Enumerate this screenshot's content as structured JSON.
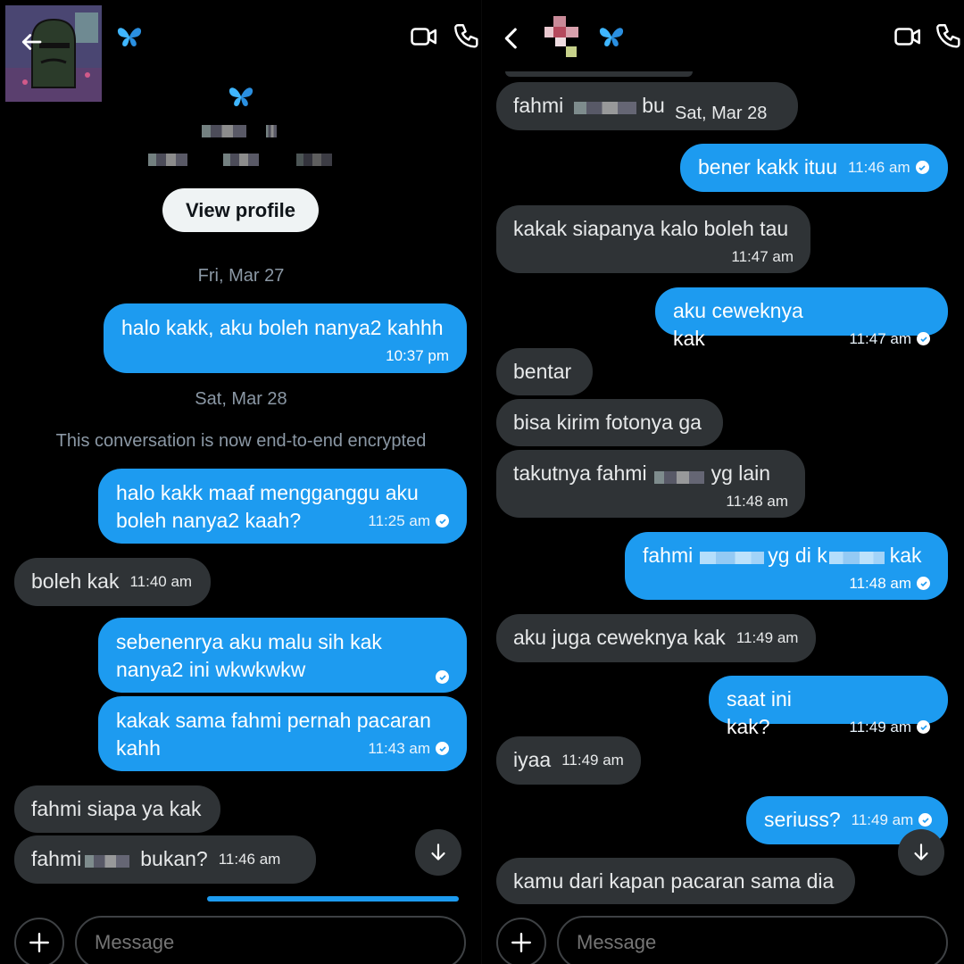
{
  "left": {
    "profile": {
      "view_profile_label": "View profile"
    },
    "dates": {
      "fri": "Fri, Mar 27",
      "sat": "Sat, Mar 28"
    },
    "system_notice": "This conversation is now end-to-end encrypted",
    "messages": [
      {
        "dir": "out",
        "line1": "halo kakk, aku boleh nanya2 kahhh",
        "line2": "",
        "time": "10:37 pm"
      },
      {
        "dir": "out",
        "line1": "halo kakk maaf mengganggu aku",
        "line2": "boleh nanya2 kaah?",
        "time": "11:25 am"
      },
      {
        "dir": "in",
        "line1": "boleh kak",
        "line2": "",
        "time": "11:40 am"
      },
      {
        "dir": "out",
        "line1": "sebenenrya aku malu sih kak",
        "line2": "nanya2 ini wkwkwkw",
        "time": ""
      },
      {
        "dir": "out",
        "line1": "kakak sama fahmi pernah pacaran",
        "line2": "kahh",
        "time": "11:43 am"
      },
      {
        "dir": "in",
        "line1": "fahmi siapa ya kak",
        "line2": "",
        "time": ""
      },
      {
        "dir": "in",
        "line1": "fahmi",
        "line2": "bukan?",
        "time": "11:46 am"
      }
    ],
    "composer": {
      "placeholder": "Message"
    }
  },
  "right": {
    "date_overlay": "Sat, Mar 28",
    "messages": [
      {
        "dir": "in",
        "line1": "fahmi",
        "line2": "bu",
        "time": ""
      },
      {
        "dir": "out",
        "line1": "bener kakk ituu",
        "line2": "",
        "time": "11:46 am"
      },
      {
        "dir": "in",
        "line1": "kakak siapanya kalo boleh tau",
        "line2": "",
        "time": "11:47 am"
      },
      {
        "dir": "out",
        "line1": "aku ceweknya kak",
        "line2": "",
        "time": "11:47 am"
      },
      {
        "dir": "in",
        "line1": "bentar",
        "line2": "",
        "time": ""
      },
      {
        "dir": "in",
        "line1": "bisa kirim fotonya ga",
        "line2": "",
        "time": ""
      },
      {
        "dir": "in",
        "line1": "takutnya fahmi",
        "line2": "yg lain",
        "time": "11:48 am"
      },
      {
        "dir": "out",
        "line1": "fahmi",
        "line2": "yg di k",
        "line3": "kak",
        "time": "11:48 am"
      },
      {
        "dir": "in",
        "line1": "aku juga ceweknya kak",
        "line2": "",
        "time": "11:49 am"
      },
      {
        "dir": "out",
        "line1": "saat ini kak?",
        "line2": "",
        "time": "11:49 am"
      },
      {
        "dir": "in",
        "line1": "iyaa",
        "line2": "",
        "time": "11:49 am"
      },
      {
        "dir": "out",
        "line1": "seriuss?",
        "line2": "",
        "time": "11:49 am"
      },
      {
        "dir": "in",
        "line1": "kamu dari kapan pacaran sama dia",
        "line2": "",
        "time": ""
      }
    ],
    "composer": {
      "placeholder": "Message"
    }
  },
  "colors": {
    "outgoing": "#1d9bf0",
    "incoming": "#2f3336",
    "background": "#000000"
  },
  "icons": [
    "back-arrow-icon",
    "butterfly-icon",
    "video-call-icon",
    "phone-icon",
    "plus-icon",
    "scroll-down-arrow-icon",
    "read-check-icon"
  ]
}
